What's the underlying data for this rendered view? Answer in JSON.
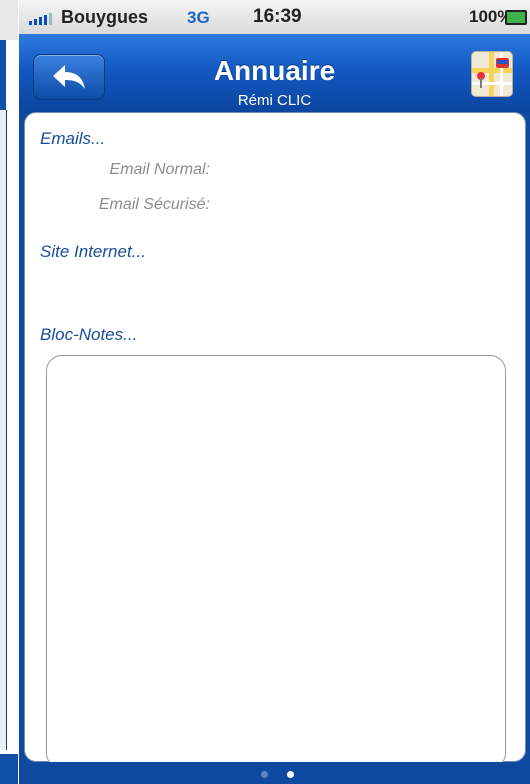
{
  "status_bar": {
    "carrier": "Bouygues",
    "network": "3G",
    "time": "16:39",
    "battery": "100%"
  },
  "nav": {
    "title": "Annuaire",
    "subtitle": "Rémi CLIC",
    "back_icon": "back-arrow-icon",
    "map_icon": "map-icon"
  },
  "content": {
    "emails_heading": "Emails...",
    "email_normal_label": "Email Normal:",
    "email_secure_label": "Email Sécurisé:",
    "website_heading": "Site Internet...",
    "notes_heading": "Bloc-Notes..."
  },
  "pager": {
    "pages": 2,
    "current": 2
  },
  "colors": {
    "nav_blue": "#1359c2",
    "heading_blue": "#1a4d9e",
    "label_gray": "#8c8c8c"
  }
}
